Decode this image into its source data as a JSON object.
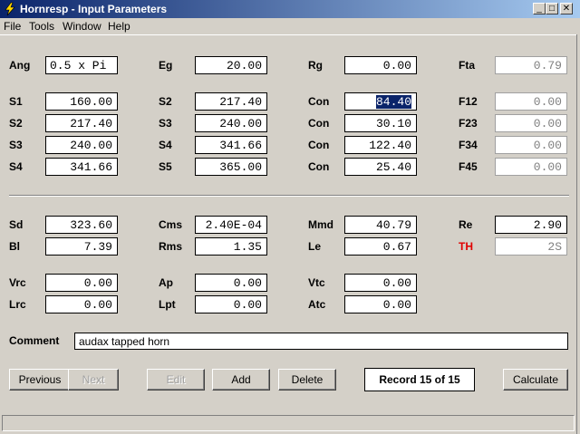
{
  "window": {
    "title": "Hornresp - Input Parameters",
    "minimize": "_",
    "maximize": "□",
    "close": "✕"
  },
  "menu": [
    "File",
    "Tools",
    "Window",
    "Help"
  ],
  "params": {
    "ang": {
      "label": "Ang",
      "value": "0.5 x Pi"
    },
    "eg": {
      "label": "Eg",
      "value": "20.00"
    },
    "rg": {
      "label": "Rg",
      "value": "0.00"
    },
    "fta": {
      "label": "Fta",
      "value": "0.79"
    },
    "s1_1": {
      "label": "S1",
      "value": "160.00"
    },
    "s2_1": {
      "label": "S2",
      "value": "217.40"
    },
    "s3_1": {
      "label": "S3",
      "value": "240.00"
    },
    "s4_1": {
      "label": "S4",
      "value": "341.66"
    },
    "s2_2": {
      "label": "S2",
      "value": "217.40"
    },
    "s3_2": {
      "label": "S3",
      "value": "240.00"
    },
    "s4_2": {
      "label": "S4",
      "value": "341.66"
    },
    "s5_2": {
      "label": "S5",
      "value": "365.00"
    },
    "con1": {
      "label": "Con",
      "value": "84.40"
    },
    "con2": {
      "label": "Con",
      "value": "30.10"
    },
    "con3": {
      "label": "Con",
      "value": "122.40"
    },
    "con4": {
      "label": "Con",
      "value": "25.40"
    },
    "f12": {
      "label": "F12",
      "value": "0.00"
    },
    "f23": {
      "label": "F23",
      "value": "0.00"
    },
    "f34": {
      "label": "F34",
      "value": "0.00"
    },
    "f45": {
      "label": "F45",
      "value": "0.00"
    },
    "sd": {
      "label": "Sd",
      "value": "323.60"
    },
    "bl": {
      "label": "Bl",
      "value": "7.39"
    },
    "cms": {
      "label": "Cms",
      "value": "2.40E-04"
    },
    "rms": {
      "label": "Rms",
      "value": "1.35"
    },
    "mmd": {
      "label": "Mmd",
      "value": "40.79"
    },
    "le": {
      "label": "Le",
      "value": "0.67"
    },
    "re": {
      "label": "Re",
      "value": "2.90"
    },
    "th": {
      "label": "TH",
      "value": "2S"
    },
    "vrc": {
      "label": "Vrc",
      "value": "0.00"
    },
    "lrc": {
      "label": "Lrc",
      "value": "0.00"
    },
    "ap": {
      "label": "Ap",
      "value": "0.00"
    },
    "lpt": {
      "label": "Lpt",
      "value": "0.00"
    },
    "vtc": {
      "label": "Vtc",
      "value": "0.00"
    },
    "atc": {
      "label": "Atc",
      "value": "0.00"
    }
  },
  "comment": {
    "label": "Comment",
    "value": "audax tapped horn"
  },
  "buttons": {
    "previous": "Previous",
    "next": "Next",
    "edit": "Edit",
    "add": "Add",
    "delete": "Delete",
    "calculate": "Calculate"
  },
  "record": "Record 15 of 15",
  "colors": {
    "title_start": "#0a246a",
    "title_end": "#a6caf0",
    "th_label": "#e00000",
    "face": "#d4d0c8"
  }
}
